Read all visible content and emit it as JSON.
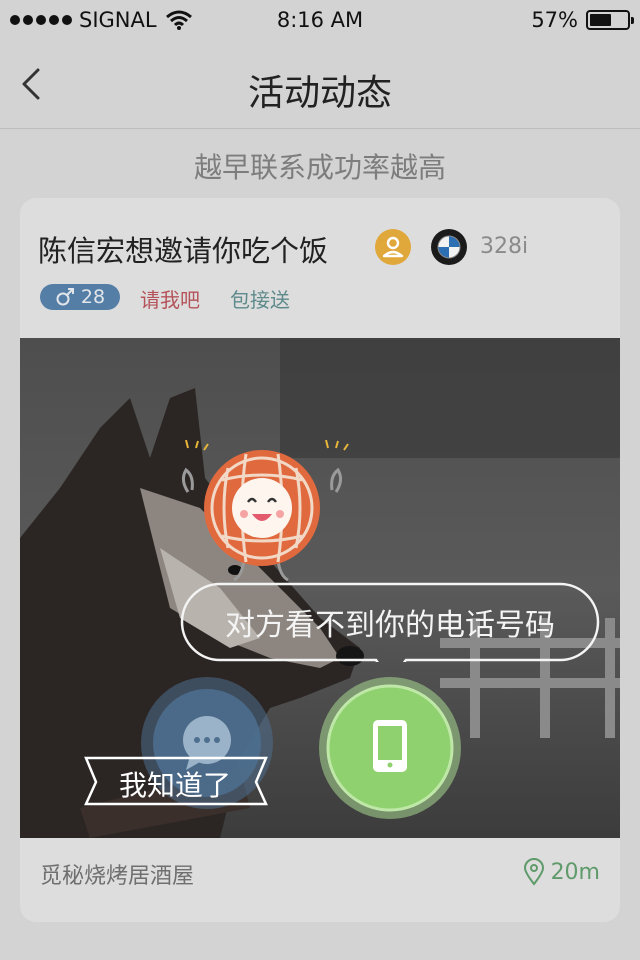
{
  "status_bar": {
    "carrier": "SIGNAL",
    "time": "8:16 AM",
    "battery_percent": "57%",
    "battery_level": 0.57
  },
  "nav": {
    "title": "活动动态",
    "back_icon": "chevron-left-icon"
  },
  "tip": "越早联系成功率越高",
  "card": {
    "title": "陈信宏想邀请你吃个饭",
    "verify_icon": "person-verified-icon",
    "car_logo": "bmw-logo",
    "car_model": "328i",
    "age": "28",
    "gender_icon": "male-icon",
    "tags": [
      "请我吧",
      "包接送"
    ],
    "venue": "觅秘烧烤居酒屋",
    "distance": "20m",
    "distance_icon": "location-pin-icon"
  },
  "guide": {
    "bubble_text": "对方看不到你的电话号码",
    "dismiss_label": "我知道了",
    "chat_icon": "chat-bubble-icon",
    "phone_icon": "phone-icon",
    "mascot": "smiling-mascot"
  },
  "colors": {
    "background": "#d3d3d3",
    "card": "#dddddd",
    "age_badge": "#557ea6",
    "tag_treat": "#b5535a",
    "tag_pickup": "#5e8a8c",
    "phone_button": "#8fd06f",
    "chat_button": "#4d6e8e",
    "mascot_orange": "#e0693e",
    "verify_icon": "#e0a73a"
  }
}
